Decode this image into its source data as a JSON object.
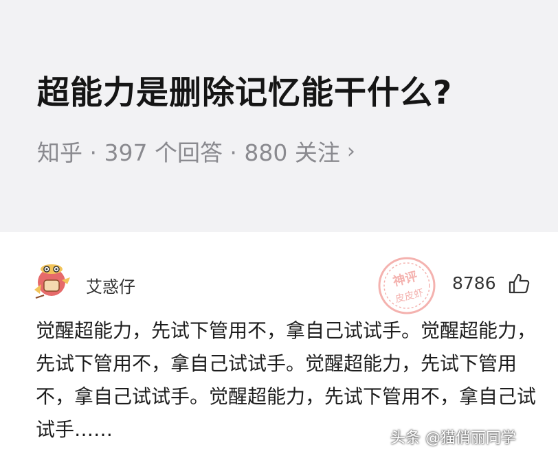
{
  "question": {
    "title": "超能力是删除记忆能干什么?",
    "meta": "知乎 · 397 个回答 · 880 关注",
    "chevron": "›"
  },
  "answer": {
    "author": "艾惑仔",
    "avatar_icon": "cartoon-character-icon",
    "stamp_text": [
      "神评",
      "皮皮虾"
    ],
    "stamp_color": "#e8574f",
    "like_count": "8786",
    "like_icon": "thumbs-up-icon",
    "text": "觉醒超能力，先试下管用不，拿自己试试手。觉醒超能力，先试下管用不，拿自己试试手。觉醒超能力，先试下管用不，拿自己试试手。觉醒超能力，先试下管用不，拿自己试试手……"
  },
  "watermark": "头条 @猫俏丽同学"
}
